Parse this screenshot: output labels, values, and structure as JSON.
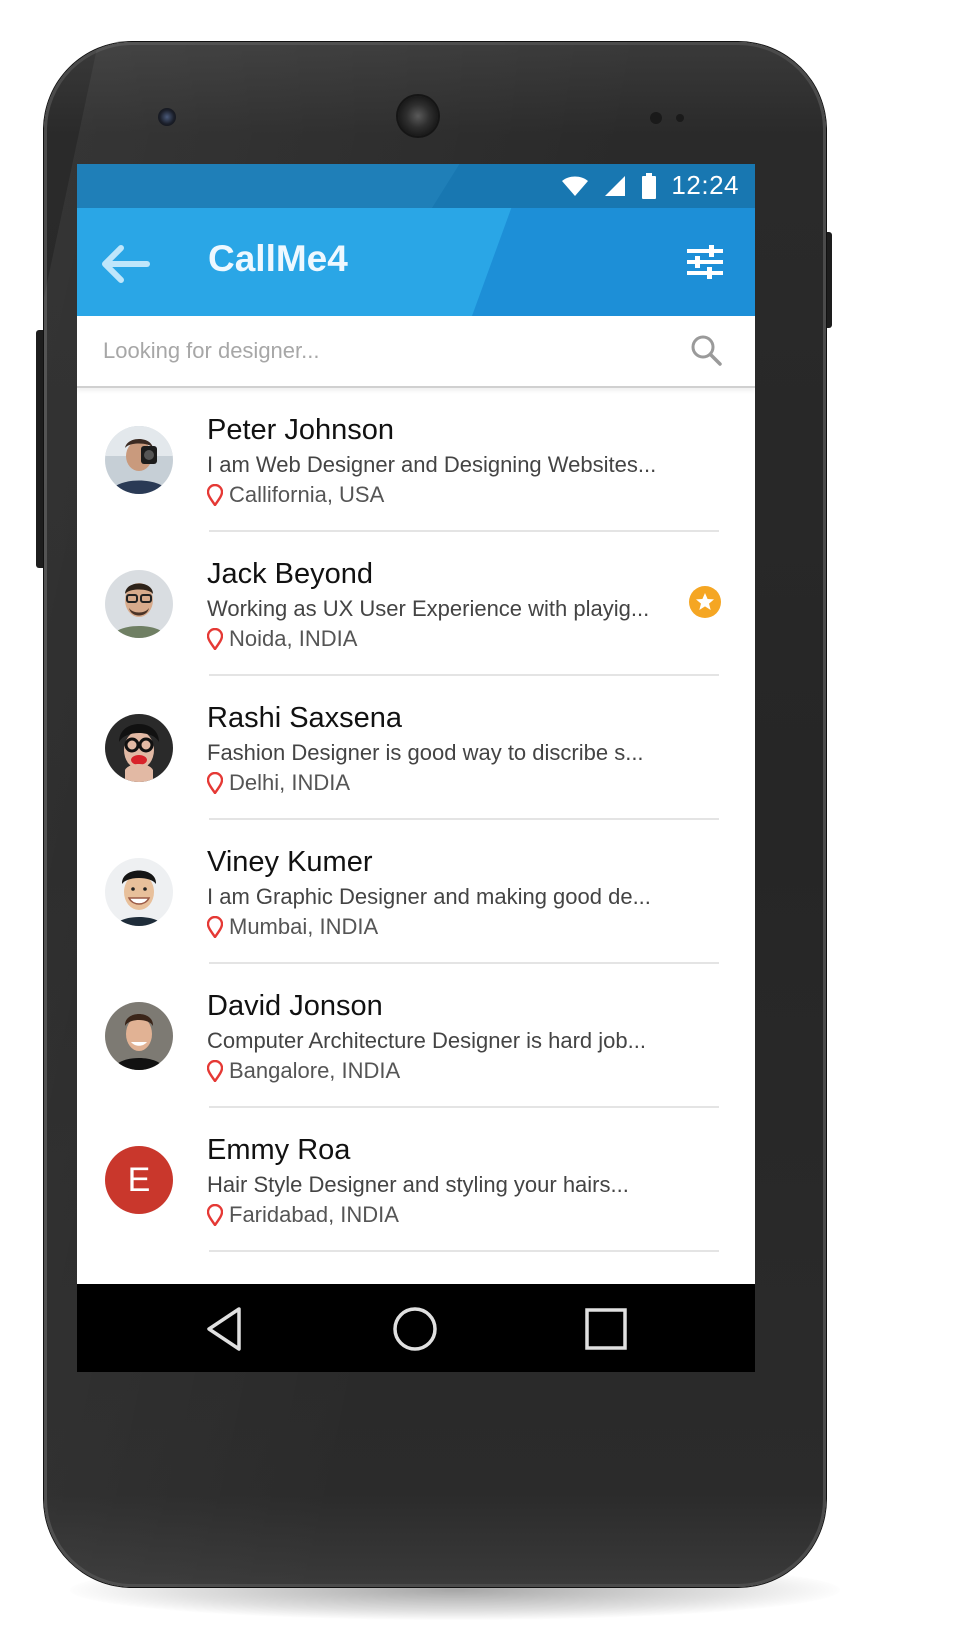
{
  "status_bar": {
    "time": "12:24"
  },
  "app_bar": {
    "title": "CallMe4"
  },
  "search": {
    "placeholder": "Looking for designer..."
  },
  "contacts": [
    {
      "name": "Peter Johnson",
      "description": "I am Web Designer and Designing Websites...",
      "location": "Callifornia, USA",
      "favorite": false
    },
    {
      "name": "Jack Beyond",
      "description": "Working as UX User Experience with playig...",
      "location": "Noida, INDIA",
      "favorite": true
    },
    {
      "name": "Rashi Saxsena",
      "description": "Fashion Designer is good way to discribe s...",
      "location": "Delhi, INDIA",
      "favorite": false
    },
    {
      "name": "Viney Kumer",
      "description": "I am Graphic Designer and making good de...",
      "location": "Mumbai, INDIA",
      "favorite": false
    },
    {
      "name": "David Jonson",
      "description": "Computer Architecture Designer is hard job...",
      "location": "Bangalore, INDIA",
      "favorite": false
    },
    {
      "name": "Emmy Roa",
      "description": "Hair Style Designer and styling your hairs...",
      "location": "Faridabad, INDIA",
      "favorite": false,
      "avatar_letter": "E"
    }
  ],
  "icons": {
    "back": "arrow-left-icon",
    "filter": "sliders-icon",
    "search": "search-icon",
    "location": "map-pin-icon",
    "favorite": "star-badge-icon",
    "wifi": "wifi-icon",
    "signal": "cell-signal-icon",
    "battery": "battery-icon",
    "nav_back": "triangle-back-icon",
    "nav_home": "circle-home-icon",
    "nav_recent": "square-recents-icon"
  },
  "colors": {
    "status_bar": "#1f7fb8",
    "app_bar": "#2aa6e6",
    "app_bar_accent": "#1d8fd7",
    "pin": "#e53935",
    "favorite": "#f5a623",
    "letter_avatar": "#c9372c"
  }
}
